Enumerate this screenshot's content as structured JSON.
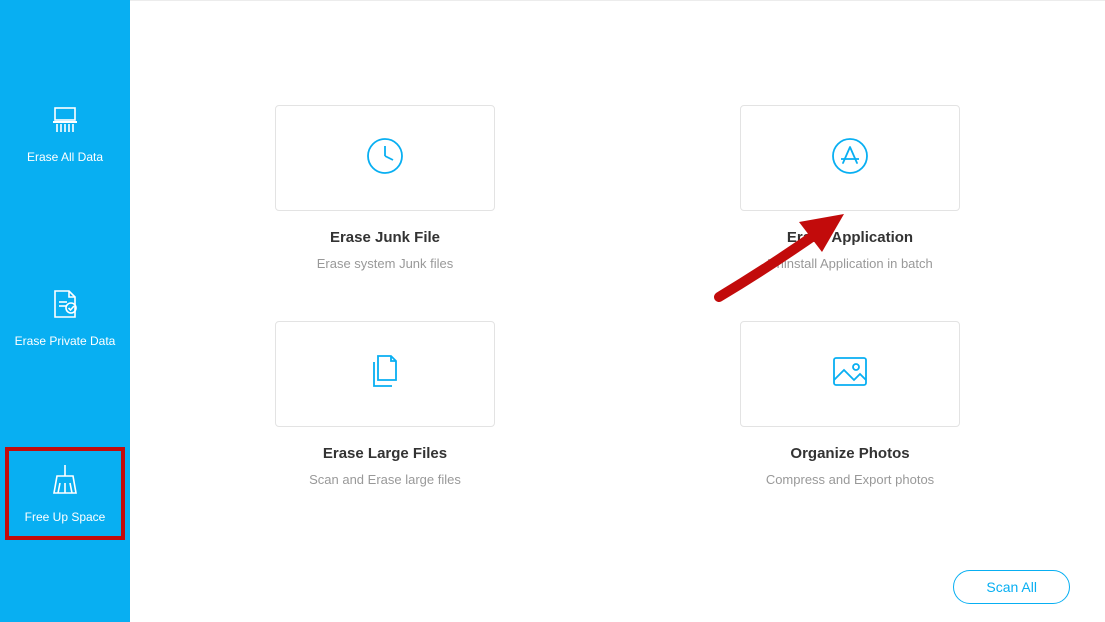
{
  "sidebar": {
    "items": [
      {
        "label": "Erase All Data"
      },
      {
        "label": "Erase Private Data"
      },
      {
        "label": "Free Up Space"
      }
    ]
  },
  "cards": [
    {
      "title": "Erase Junk File",
      "desc": "Erase system Junk files"
    },
    {
      "title": "Erase Application",
      "desc": "Uninstall Application in batch"
    },
    {
      "title": "Erase Large Files",
      "desc": "Scan and Erase large files"
    },
    {
      "title": "Organize Photos",
      "desc": "Compress and Export photos"
    }
  ],
  "actions": {
    "scan_all": "Scan All"
  },
  "colors": {
    "accent": "#08aff2",
    "highlight": "#c20b0b",
    "arrow": "#c20b0b"
  }
}
